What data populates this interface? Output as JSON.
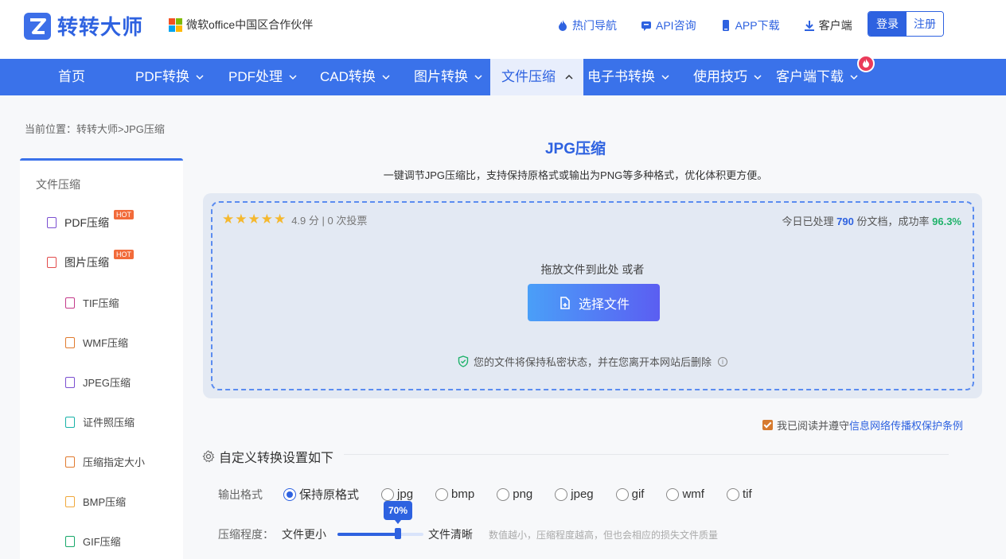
{
  "header": {
    "brand": "转转大师",
    "partner": "微软office中国区合作伙伴",
    "links": [
      {
        "label": "热门导航",
        "icon": "flame-icon"
      },
      {
        "label": "API咨询",
        "icon": "chat-icon"
      },
      {
        "label": "APP下载",
        "icon": "phone-icon"
      },
      {
        "label": "客户端",
        "icon": "download-icon"
      }
    ],
    "login": "登录",
    "register": "注册"
  },
  "nav": {
    "items": [
      "首页",
      "PDF转换",
      "PDF处理",
      "CAD转换",
      "图片转换",
      "文件压缩",
      "电子书转换",
      "使用技巧",
      "客户端下载"
    ],
    "active": "文件压缩"
  },
  "breadcrumb": "当前位置：转转大师>JPG压缩",
  "sidebar": {
    "title": "文件压缩",
    "hot": "HOT",
    "items": [
      {
        "label": "PDF压缩",
        "color": "#7b4fd1"
      },
      {
        "label": "图片压缩",
        "color": "#e24b4b"
      },
      {
        "label": "TIF压缩",
        "color": "#c43a8a"
      },
      {
        "label": "WMF压缩",
        "color": "#e07a2e"
      },
      {
        "label": "JPEG压缩",
        "color": "#7b4fd1"
      },
      {
        "label": "证件照压缩",
        "color": "#18b2a8"
      },
      {
        "label": "压缩指定大小",
        "color": "#e07a2e"
      },
      {
        "label": "BMP压缩",
        "color": "#f0a83a"
      },
      {
        "label": "GIF压缩",
        "color": "#18a86a"
      }
    ]
  },
  "main": {
    "title": "JPG压缩",
    "subtitle": "一键调节JPG压缩比，支持保持原格式或输出为PNG等多种格式，优化体积更方便。",
    "rating_stars": "★★★★★",
    "rating": "4.9 分 | 0 次投票",
    "stats_prefix": "今日已处理",
    "stats_count": "790",
    "stats_mid": "份文档，成功率",
    "stats_rate": "96.3%",
    "drop_text": "拖放文件到此处 或者",
    "choose_btn": "选择文件",
    "privacy": "您的文件将保持私密状态，并在您离开本网站后删除",
    "agree_prefix": "我已阅读并遵守",
    "agree_link": "信息网络传播权保护条例",
    "settings_title": "自定义转换设置如下",
    "format_label": "输出格式",
    "formats": [
      "保持原格式",
      "jpg",
      "bmp",
      "png",
      "jpeg",
      "gif",
      "wmf",
      "tif"
    ],
    "format_selected": "保持原格式",
    "compress_label": "压缩程度：",
    "compress_min": "文件更小",
    "compress_max": "文件清晰",
    "compress_value": "70%",
    "compress_level": 0.7,
    "compress_hint": "数值越小，压缩程度越高，但也会相应的损失文件质量"
  },
  "colors": {
    "brand_blue": "#2e62e0",
    "nav_bg": "#3a72ea",
    "hot_badge": "#f26b3a",
    "success": "#1fb26a"
  }
}
